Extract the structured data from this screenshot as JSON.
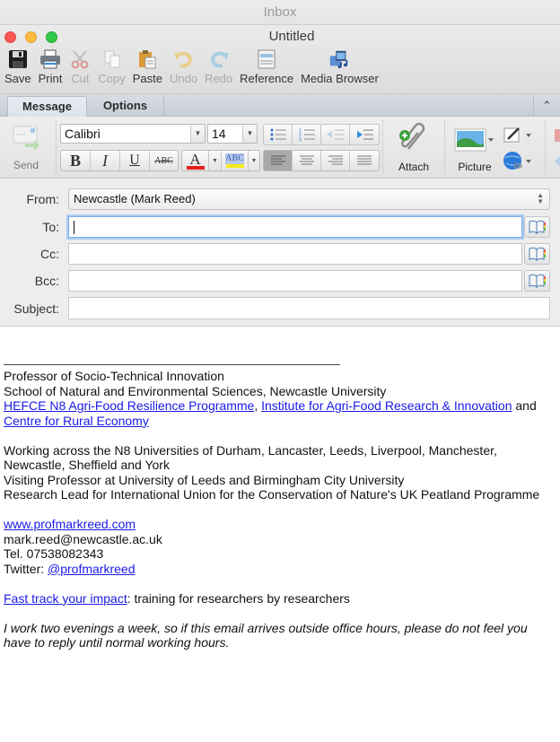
{
  "inbox_bar": {
    "title": "Inbox"
  },
  "window": {
    "title": "Untitled"
  },
  "toolbar": {
    "items": [
      {
        "label": "Save",
        "icon": "floppy-disk-icon",
        "enabled": true
      },
      {
        "label": "Print",
        "icon": "printer-icon",
        "enabled": true
      },
      {
        "label": "Cut",
        "icon": "scissors-icon",
        "enabled": false
      },
      {
        "label": "Copy",
        "icon": "copy-icon",
        "enabled": false
      },
      {
        "label": "Paste",
        "icon": "clipboard-icon",
        "enabled": true
      },
      {
        "label": "Undo",
        "icon": "undo-icon",
        "enabled": false
      },
      {
        "label": "Redo",
        "icon": "redo-icon",
        "enabled": false
      },
      {
        "label": "Reference",
        "icon": "reference-icon",
        "enabled": true
      },
      {
        "label": "Media Browser",
        "icon": "media-browser-icon",
        "enabled": true
      }
    ]
  },
  "ribbon": {
    "tabs": [
      {
        "label": "Message",
        "active": true
      },
      {
        "label": "Options",
        "active": false
      }
    ],
    "send_label": "Send",
    "font_name": "Calibri",
    "font_size": "14",
    "format_buttons": {
      "bold": "B",
      "italic": "I",
      "underline": "U",
      "strikethrough": "ABC",
      "font_color": "A",
      "highlight": "ABC"
    },
    "attach_label": "Attach",
    "picture_label": "Picture",
    "colors": {
      "font_color": "#e8201a",
      "highlight": "#f5ec1c"
    }
  },
  "header": {
    "from_label": "From:",
    "from_value": "Newcastle (Mark Reed)",
    "to_label": "To:",
    "to_value": "",
    "cc_label": "Cc:",
    "cc_value": "",
    "bcc_label": "Bcc:",
    "bcc_value": "",
    "subject_label": "Subject:",
    "subject_value": ""
  },
  "body": {
    "title_line": "Professor of Socio-Technical Innovation",
    "school_line": "School of Natural and Environmental Sciences, Newcastle University",
    "link_hefce": "HEFCE N8 Agri-Food Resilience Programme",
    "sep_comma": ", ",
    "link_institute": "Institute for Agri-Food Research & Innovation",
    "and_text": " and",
    "link_centre": "Centre for Rural Economy",
    "working_line_1": "Working across the N8 Universities of Durham, Lancaster, Leeds, Liverpool, Manchester,",
    "working_line_2": "Newcastle, Sheffield and York",
    "visiting_line": "Visiting Professor at University of Leeds and Birmingham City University",
    "research_line": "Research Lead for International Union for the Conservation of Nature's UK Peatland Programme",
    "website_link": "www.profmarkreed.com",
    "email_text": "mark.reed@newcastle.ac.uk",
    "tel_text": "Tel. 07538082343",
    "twitter_prefix": "Twitter: ",
    "twitter_link": "@profmarkreed",
    "fasttrack_link": "Fast track your impact",
    "fasttrack_suffix": ": training for researchers by researchers",
    "note_line_1": "I work two evenings a week, so if this email arrives outside office hours, please do not feel you",
    "note_line_2": "have to reply until normal working hours."
  }
}
